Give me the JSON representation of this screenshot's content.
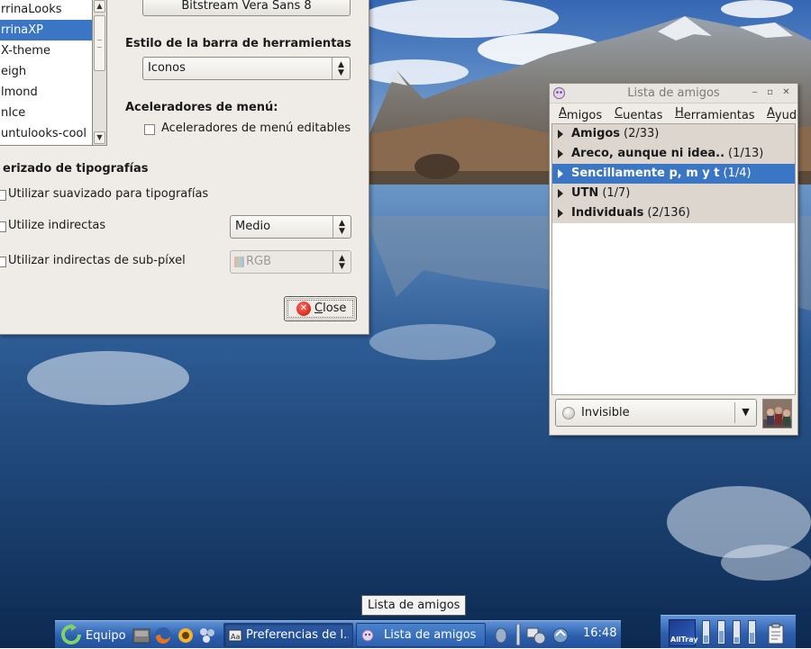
{
  "preferences": {
    "theme_list": [
      "rrinaLooks",
      "rrinaXP",
      "X-theme",
      "eigh",
      "lmond",
      "nIce",
      "untulooks-cool"
    ],
    "selected_theme_index": 1,
    "font_button_label": "Bitstream Vera Sans 8",
    "toolbar_style_heading": "Estilo de la barra de herramientas",
    "toolbar_style_value": "Iconos",
    "menu_accel_heading": "Aceleradores de menú:",
    "menu_accel_checkbox": "Aceleradores de menú editables",
    "font_render_heading": "erizado de tipografías",
    "antialias_checkbox": "Utilizar suavizado para tipografías",
    "hinting_checkbox": "Utilize indirectas",
    "hinting_value": "Medio",
    "subpixel_checkbox": "Utilizar indirectas de sub-píxel",
    "subpixel_value": "RGB",
    "close_label": "Close",
    "close_icon_glyph": "✕"
  },
  "buddy_list": {
    "title": "Lista de amigos",
    "window_buttons": {
      "minimize": "‒",
      "maximize": "▫",
      "close": "✕"
    },
    "menu": [
      {
        "mnemonic": "A",
        "rest": "migos"
      },
      {
        "mnemonic": "C",
        "rest": "uentas"
      },
      {
        "mnemonic": "H",
        "rest": "erramientas"
      },
      {
        "mnemonic": "A",
        "rest": "yud"
      }
    ],
    "groups": [
      {
        "name": "Amigos",
        "count": "(2/33)",
        "selected": false
      },
      {
        "name": "Areco, aunque ni idea..",
        "count": "(1/13)",
        "selected": false
      },
      {
        "name": "Sencillamente p, m y t",
        "count": "(1/4)",
        "selected": true
      },
      {
        "name": "UTN",
        "count": "(1/7)",
        "selected": false
      },
      {
        "name": "Individuals",
        "count": "(2/136)",
        "selected": false
      }
    ],
    "status": "Invisible"
  },
  "tooltip": "Lista de amigos",
  "taskbar": {
    "menu_label": "Equipo",
    "tasks": [
      {
        "label": "Preferencias de l...",
        "active": true
      },
      {
        "label": "Lista de amigos",
        "active": false
      }
    ],
    "clock": "16:48",
    "tray_app_label": "AllTray",
    "meters": [
      0.35,
      0.55,
      0.25,
      0.45
    ]
  },
  "colors": {
    "selection": "#3a76c4",
    "taskbar": "#2d5fae",
    "window_bg": "#efebe7",
    "group_bg": "#dcd6cf"
  }
}
